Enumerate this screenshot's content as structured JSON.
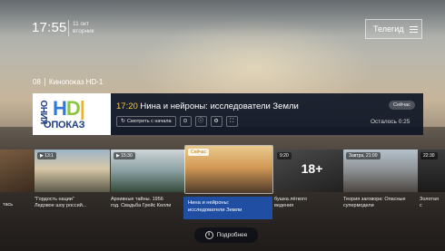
{
  "topbar": {
    "time": "17:55",
    "date_line1": "11 окт",
    "date_line2": "вторник",
    "guide_button": "Телегид",
    "guide_icon": "menu-icon"
  },
  "channel": {
    "number": "08",
    "name": "Кинопоказ HD-1"
  },
  "logo": {
    "vertical": "КИНО",
    "hd": "HD",
    "pokaz": "ОПОКАЗ"
  },
  "program": {
    "time": "17:20",
    "title": "Нина и нейроны: исследователи Земли",
    "now_badge": "Сейчас",
    "remaining": "Осталось 0:25",
    "controls": {
      "restart_label": "Смотреть с начала",
      "restart_icon": "restart-icon",
      "icons": [
        "record-icon",
        "info-icon",
        "settings-icon",
        "fullscreen-icon"
      ]
    }
  },
  "cards": [
    {
      "badge": "",
      "age": "",
      "caption_l1": "тась",
      "caption_l2": ""
    },
    {
      "badge": "▶ 13:1",
      "age": "",
      "caption_l1": "\"Гордость нации\"",
      "caption_l2": "Ледовое шоу россий..."
    },
    {
      "badge": "▶ 15:30",
      "age": "",
      "caption_l1": "Архивные тайны. 1956",
      "caption_l2": "год. Свадьба Грейс Келли"
    },
    {
      "badge": "Сейчас",
      "age": "",
      "caption_l1": "",
      "caption_l2": ""
    },
    {
      "badge": "9:20",
      "age": "18+",
      "caption_l1": "бушка лёгкого",
      "caption_l2": "ведения"
    },
    {
      "badge": "Завтра, 21:00",
      "age": "",
      "caption_l1": "Теория заговора: Опасные",
      "caption_l2": "супермодели"
    },
    {
      "badge": "22:30",
      "age": "",
      "caption_l1": "Золотая",
      "caption_l2": "с"
    }
  ],
  "tooltip": {
    "line1": "Нина и нейроны:",
    "line2": "исследователи Земли"
  },
  "more": {
    "label": "Подробнее",
    "icon": "info-icon"
  }
}
